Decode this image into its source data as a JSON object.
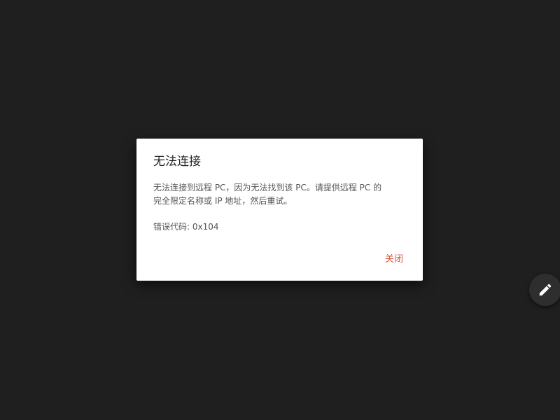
{
  "dialog": {
    "title": "无法连接",
    "message_line1": "无法连接到远程 PC，因为无法找到该 PC。请提供远程 PC 的",
    "message_line2": "完全限定名称或 IP 地址，然后重试。",
    "error_code": "错误代码: 0x104",
    "close_label": "关闭"
  },
  "fab": {
    "icon": "pencil-icon"
  },
  "colors": {
    "background": "#1f1f1f",
    "dialog_bg": "#ffffff",
    "accent": "#d9583b"
  }
}
